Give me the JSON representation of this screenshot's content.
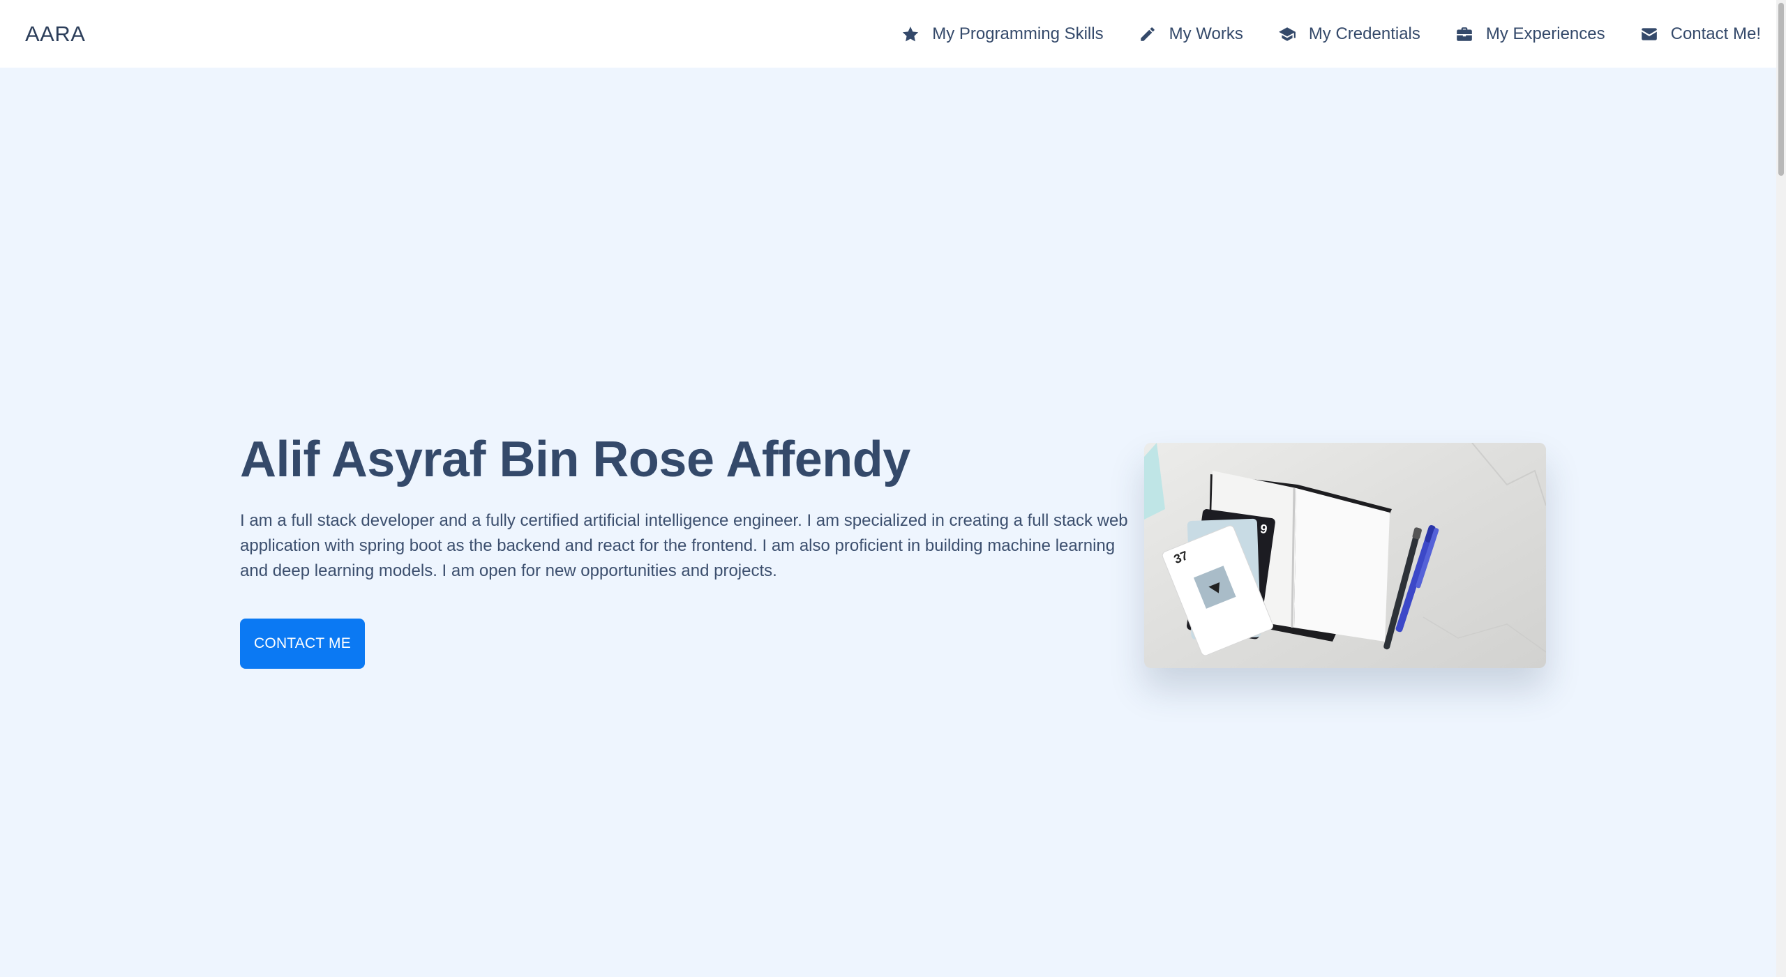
{
  "brand": "AARA",
  "nav": {
    "items": [
      {
        "label": "My Programming Skills",
        "icon": "star-icon"
      },
      {
        "label": "My Works",
        "icon": "pencil-icon"
      },
      {
        "label": "My Credentials",
        "icon": "graduation-cap-icon"
      },
      {
        "label": "My Experiences",
        "icon": "briefcase-icon"
      },
      {
        "label": "Contact Me!",
        "icon": "envelope-icon"
      }
    ]
  },
  "hero": {
    "title": "Alif Asyraf Bin Rose Affendy",
    "description": "I am a full stack developer and a fully certified artificial intelligence engineer. I am specialized in creating a full stack web application with spring boot as the backend and react for the frontend. I am also proficient in building machine learning and deep learning models. I am open for new opportunities and projects.",
    "button_label": "CONTACT ME",
    "image": "notebook-pens-cards-photo"
  },
  "colors": {
    "background": "#eef5fe",
    "navbar": "#ffffff",
    "text": "#34496a",
    "button": "#0b79f3"
  }
}
